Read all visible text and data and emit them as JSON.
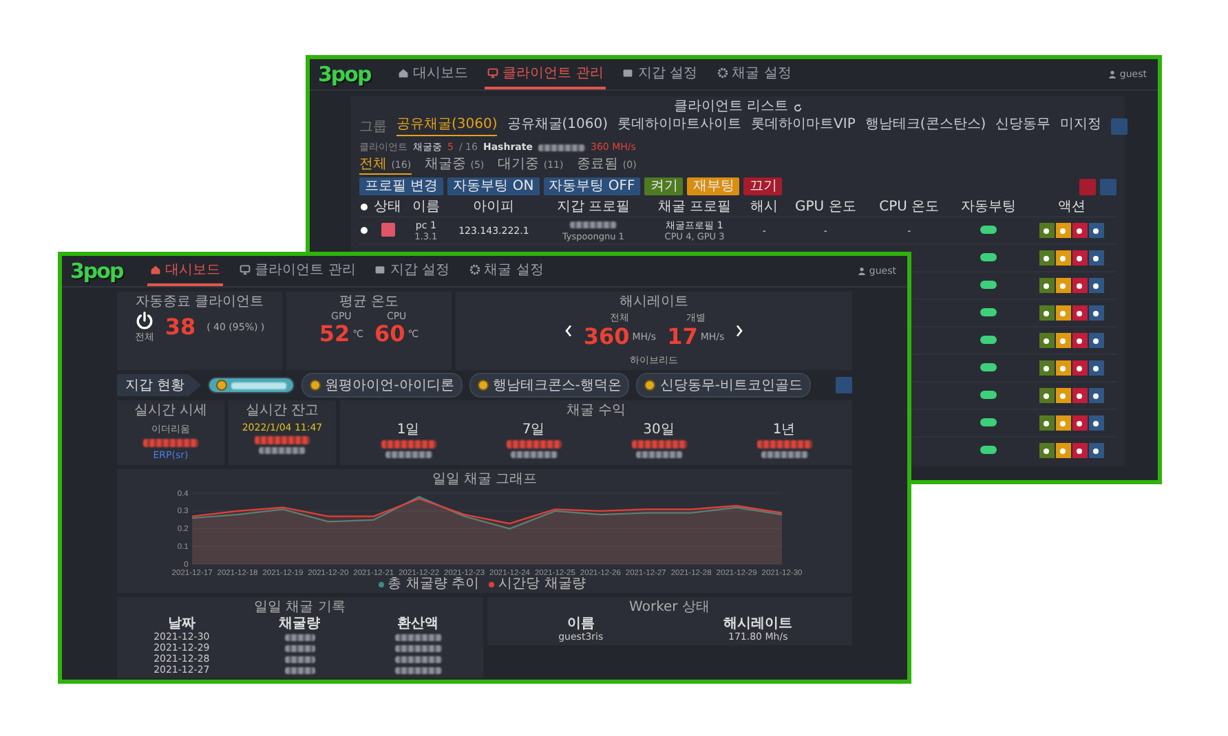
{
  "back_window": {
    "logo": "3pop",
    "nav": [
      {
        "label": "대시보드",
        "selected": false
      },
      {
        "label": "클라이언트 관리",
        "selected": true
      },
      {
        "label": "지갑 설정",
        "selected": false
      },
      {
        "label": "채굴 설정",
        "selected": false
      }
    ],
    "user": "guest",
    "title": "클라이언트 리스트",
    "group_label": "그룹",
    "groups": [
      {
        "label": "공유채굴(3060)",
        "selected": true
      },
      {
        "label": "공유채굴(1060)",
        "selected": false
      },
      {
        "label": "롯데하이마트사이트",
        "selected": false
      },
      {
        "label": "롯데하이마트VIP",
        "selected": false
      },
      {
        "label": "행남테크(콘스탄스)",
        "selected": false
      },
      {
        "label": "신당동무",
        "selected": false
      },
      {
        "label": "미지정",
        "selected": false
      }
    ],
    "summary": {
      "label": "클라이언트",
      "mining_label": "채굴중",
      "mining": "5",
      "total": "/ 16",
      "hashrate_label": "Hashrate",
      "hashrate": "360 MH/s"
    },
    "status_tabs": [
      {
        "label": "전체",
        "count": "(16)",
        "selected": true
      },
      {
        "label": "채굴중",
        "count": "(5)",
        "selected": false
      },
      {
        "label": "대기중",
        "count": "(11)",
        "selected": false
      },
      {
        "label": "종료됨",
        "count": "(0)",
        "selected": false
      }
    ],
    "select_all_checked": false,
    "buttons": [
      {
        "label": "프로필 변경",
        "kind": "primary"
      },
      {
        "label": "자동부팅 ON",
        "kind": "primary"
      },
      {
        "label": "자동부팅 OFF",
        "kind": "primary"
      },
      {
        "label": "켜기",
        "kind": "success"
      },
      {
        "label": "재부팅",
        "kind": "warning"
      },
      {
        "label": "끄기",
        "kind": "danger"
      }
    ],
    "columns": [
      "상태",
      "이름",
      "아이피",
      "지갑 프로필",
      "채굴 프로필",
      "해시",
      "GPU 온도",
      "CPU 온도",
      "자동부팅",
      "액션"
    ],
    "rows": [
      {
        "checked": false,
        "name": "pc 1",
        "version": "1.3.1",
        "ip": "123.143.222.1",
        "wallet_note": "Tyspoongnu 1",
        "mining_profile": "채굴프로필 1",
        "mining_note": "CPU 4, GPU 3",
        "hash": "-",
        "gpu": "-",
        "cpu": "-",
        "autoboot": true
      },
      {
        "autoboot": true
      },
      {
        "autoboot": true
      },
      {
        "autoboot": true
      },
      {
        "autoboot": true
      },
      {
        "autoboot": true
      },
      {
        "autoboot": true
      },
      {
        "autoboot": true
      },
      {
        "autoboot": true
      }
    ]
  },
  "front_window": {
    "logo": "3pop",
    "nav": [
      {
        "label": "대시보드",
        "selected": true
      },
      {
        "label": "클라이언트 관리",
        "selected": false
      },
      {
        "label": "지갑 설정",
        "selected": false
      },
      {
        "label": "채굴 설정",
        "selected": false
      }
    ],
    "user": "guest",
    "clients": {
      "title": "자동종료 클라이언트",
      "icon_label": "전체",
      "value": "38",
      "note": "( 40 (95%) )"
    },
    "temperature": {
      "title": "평균 온도",
      "items": [
        {
          "label": "GPU",
          "value": "52",
          "unit": "℃"
        },
        {
          "label": "CPU",
          "value": "60",
          "unit": "℃"
        }
      ]
    },
    "hashrate": {
      "title": "해시레이트",
      "items": [
        {
          "label": "전체",
          "value": "360",
          "unit": "MH/s"
        },
        {
          "label": "개별",
          "value": "17",
          "unit": "MH/s"
        }
      ],
      "note": "하이브리드"
    },
    "wallet_tag": "지갑 현황",
    "wallets": [
      {
        "label": "원평아이언-아이디론",
        "selected": false
      },
      {
        "label": "행남테크콘스-행덕온",
        "selected": false
      },
      {
        "label": "신당동무-비트코인골드",
        "selected": false
      }
    ],
    "price": {
      "title": "실시간 시세",
      "coin": "이더리움",
      "unit": "ERP(sr)"
    },
    "balance": {
      "title": "실시간 잔고",
      "time": "2022/1/04 11:47"
    },
    "revenue": {
      "title": "채굴 수익",
      "periods": [
        "1일",
        "7일",
        "30일",
        "1년"
      ]
    },
    "graph": {
      "title": "일일 채굴 그래프",
      "chart_data": {
        "type": "area",
        "x": [
          "2021-12-17",
          "2021-12-18",
          "2021-12-19",
          "2021-12-20",
          "2021-12-21",
          "2021-12-22",
          "2021-12-23",
          "2021-12-24",
          "2021-12-25",
          "2021-12-26",
          "2021-12-27",
          "2021-12-28",
          "2021-12-29",
          "2021-12-30"
        ],
        "grid": true,
        "ylim": [
          0,
          0.4
        ],
        "yticks": [
          0,
          0.1,
          0.2,
          0.3,
          0.4
        ],
        "series": [
          {
            "name": "총 채굴량 추이",
            "color": "#3d8c84",
            "values": [
              0.26,
              0.28,
              0.31,
              0.24,
              0.25,
              0.38,
              0.27,
              0.2,
              0.3,
              0.28,
              0.29,
              0.29,
              0.32,
              0.28
            ]
          },
          {
            "name": "시간당 채굴량",
            "color": "#e0403a",
            "values": [
              0.27,
              0.3,
              0.32,
              0.27,
              0.27,
              0.37,
              0.28,
              0.23,
              0.31,
              0.3,
              0.31,
              0.31,
              0.33,
              0.29
            ]
          }
        ]
      }
    },
    "history": {
      "title": "일일 채굴 기록",
      "columns": [
        "날짜",
        "채굴량",
        "환산액"
      ],
      "dates": [
        "2021-12-30",
        "2021-12-29",
        "2021-12-28",
        "2021-12-27"
      ]
    },
    "workers": {
      "title": "Worker 상태",
      "columns": [
        "이름",
        "해시레이트"
      ],
      "rows": [
        {
          "name": "guest3ris",
          "hashrate": "171.80 Mh/s"
        }
      ]
    }
  }
}
